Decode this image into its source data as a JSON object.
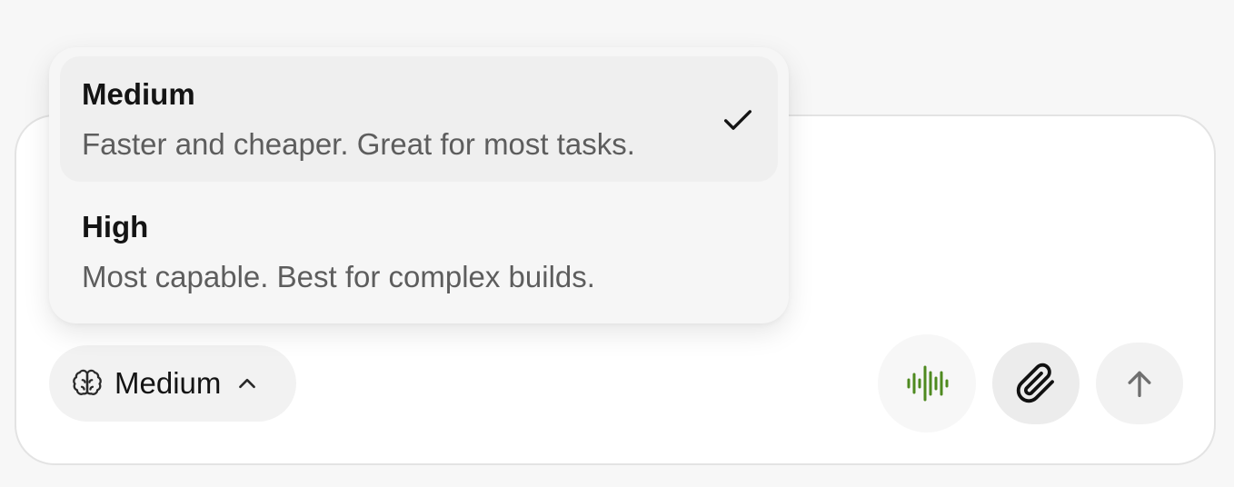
{
  "dropdown": {
    "options": [
      {
        "title": "Medium",
        "description": "Faster and cheaper. Great for most tasks.",
        "selected": true
      },
      {
        "title": "High",
        "description": "Most capable. Best for complex builds.",
        "selected": false
      }
    ]
  },
  "toolbar": {
    "effort_label": "Medium",
    "icons": {
      "effort": "brain-icon",
      "chevron": "chevron-up-icon",
      "voice": "voice-waveform-icon",
      "attach": "paperclip-icon",
      "send": "arrow-up-icon"
    }
  },
  "colors": {
    "voice_accent": "#4e8a1f",
    "background": "#f7f7f7",
    "composer": "#ffffff"
  }
}
